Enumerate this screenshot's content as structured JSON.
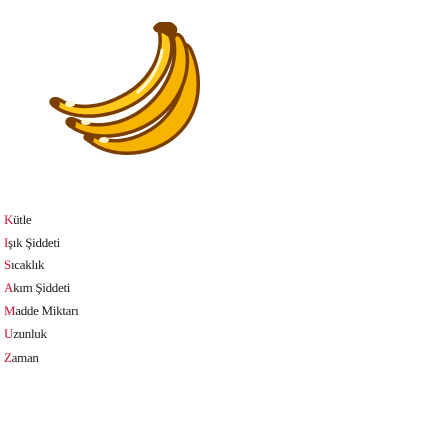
{
  "image": {
    "icon": "banana-bunch-icon",
    "colors": {
      "outline": "#7a3e00",
      "fill": "#f6b400",
      "highlight": "#ffd640",
      "shine": "#fff6cc"
    }
  },
  "words": [
    {
      "first": "K",
      "rest": "ütle"
    },
    {
      "first": "I",
      "rest": "şık Şiddeti"
    },
    {
      "first": "S",
      "rest": "ıcaklık"
    },
    {
      "first": "A",
      "rest": "kım Şiddeti"
    },
    {
      "first": "M",
      "rest": "adde Miktarı"
    },
    {
      "first": "U",
      "rest": "zunluk"
    },
    {
      "first": "Z",
      "rest": "aman"
    }
  ],
  "colors": {
    "initial_letter": "#c8102e",
    "text": "#1a1a1a",
    "background": "#ffffff"
  }
}
